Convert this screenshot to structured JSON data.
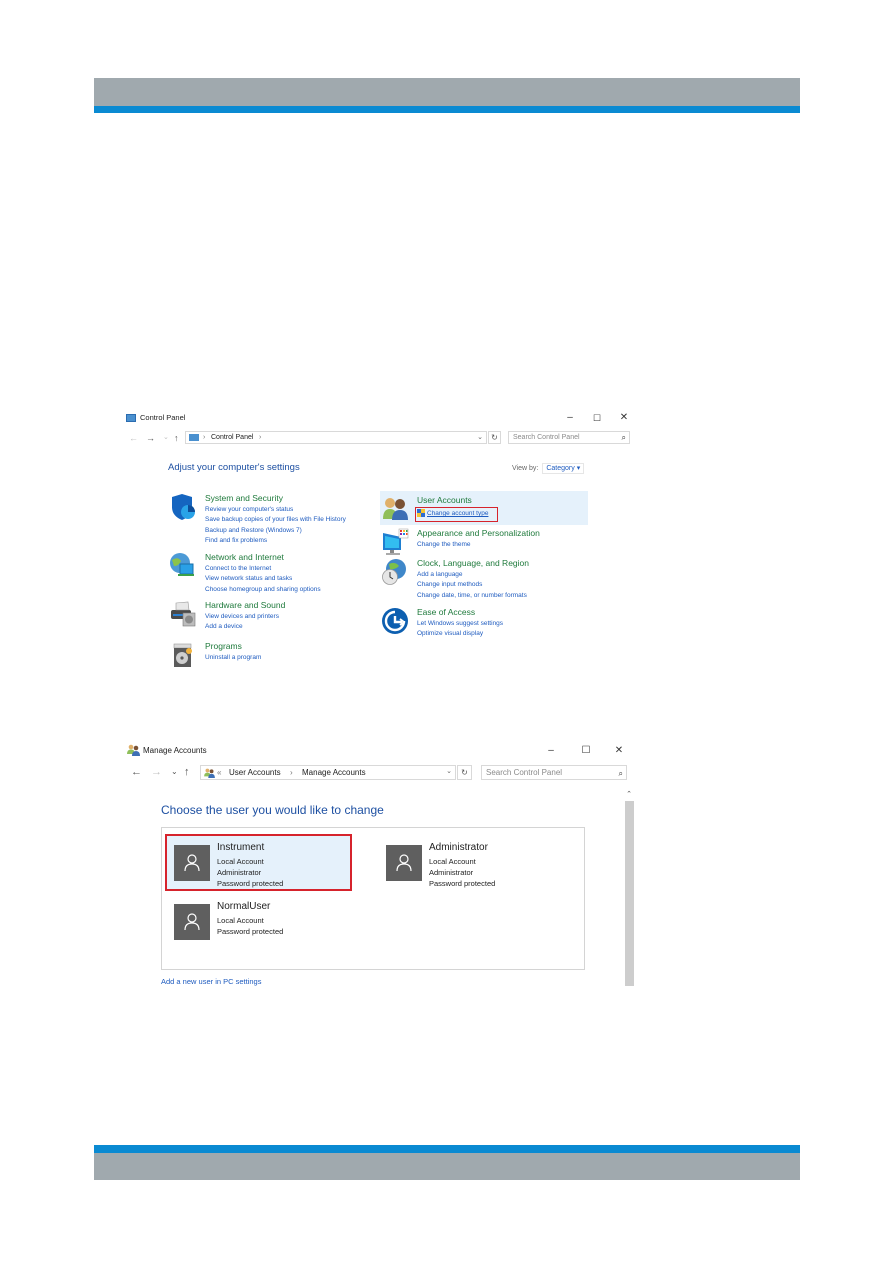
{
  "colors": {
    "header_gray": "#a0a9ae",
    "brand_blue": "#0a8ad2",
    "category_green": "#1f7a3c",
    "link_blue": "#1e5bbf",
    "heading_blue": "#1e50a2",
    "highlight_red": "#d6232c",
    "selection_bg": "#e5f1fb"
  },
  "control_panel": {
    "title": "Control Panel",
    "window_controls": {
      "minimize": "–",
      "maximize": "☐",
      "close": "✕"
    },
    "nav": {
      "back": "←",
      "forward": "→",
      "recent": "⌄",
      "up": "↑"
    },
    "address": {
      "sep1": "›",
      "crumb": "Control Panel",
      "sep2": "›",
      "dropdown": "⌄"
    },
    "refresh": "↻",
    "search_placeholder": "Search Control Panel",
    "search_icon": "⌕",
    "heading": "Adjust your computer's settings",
    "view_by_label": "View by:",
    "view_by_value": "Category ▾",
    "categories_left": [
      {
        "icon": "shield-icon",
        "title": "System and Security",
        "links": [
          "Review your computer's status",
          "Save backup copies of your files with File History",
          "Backup and Restore (Windows 7)",
          "Find and fix problems"
        ]
      },
      {
        "icon": "network-globe-icon",
        "title": "Network and Internet",
        "links": [
          "Connect to the Internet",
          "View network status and tasks",
          "Choose homegroup and sharing options"
        ]
      },
      {
        "icon": "printer-icon",
        "title": "Hardware and Sound",
        "links": [
          "View devices and printers",
          "Add a device"
        ]
      },
      {
        "icon": "programs-disc-icon",
        "title": "Programs",
        "links": [
          "Uninstall a program"
        ]
      }
    ],
    "categories_right": [
      {
        "icon": "users-icon",
        "title": "User Accounts",
        "links": [
          "Change account type"
        ]
      },
      {
        "icon": "monitor-palette-icon",
        "title": "Appearance and Personalization",
        "links": [
          "Change the theme"
        ]
      },
      {
        "icon": "clock-globe-icon",
        "title": "Clock, Language, and Region",
        "links": [
          "Add a language",
          "Change input methods",
          "Change date, time, or number formats"
        ]
      },
      {
        "icon": "ease-of-access-icon",
        "title": "Ease of Access",
        "links": [
          "Let Windows suggest settings",
          "Optimize visual display"
        ]
      }
    ]
  },
  "manage_accounts": {
    "title": "Manage Accounts",
    "window_controls": {
      "minimize": "–",
      "maximize": "☐",
      "close": "✕"
    },
    "nav": {
      "back": "←",
      "forward": "→",
      "recent": "⌄",
      "up": "↑"
    },
    "address": {
      "overflow": "«",
      "crumb1": "User Accounts",
      "sep": "›",
      "crumb2": "Manage Accounts",
      "dropdown": "⌄"
    },
    "refresh": "↻",
    "search_placeholder": "Search Control Panel",
    "search_icon": "⌕",
    "heading": "Choose the user you would like to change",
    "accounts": [
      {
        "name": "Instrument",
        "details": [
          "Local Account",
          "Administrator",
          "Password protected"
        ],
        "selected": true
      },
      {
        "name": "Administrator",
        "details": [
          "Local Account",
          "Administrator",
          "Password protected"
        ],
        "selected": false
      },
      {
        "name": "NormalUser",
        "details": [
          "Local Account",
          "Password protected"
        ],
        "selected": false
      }
    ],
    "add_user_link": "Add a new user in PC settings",
    "scroll_up": "⌃"
  }
}
